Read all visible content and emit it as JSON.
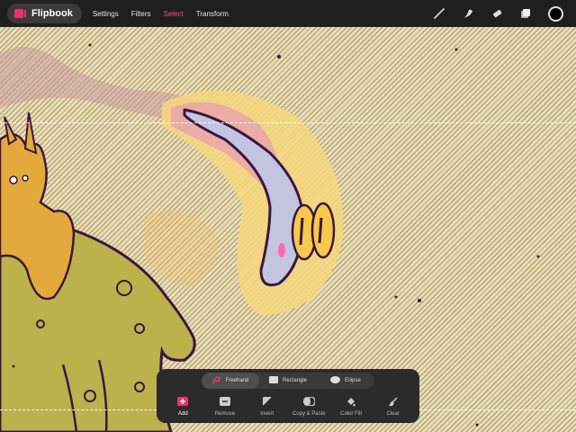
{
  "app": {
    "name": "Flipbook"
  },
  "menu": [
    {
      "label": "Settings",
      "active": false
    },
    {
      "label": "Filters",
      "active": false
    },
    {
      "label": "Select",
      "active": true
    },
    {
      "label": "Transform",
      "active": false
    }
  ],
  "tools": [
    "brush-icon",
    "smudge-icon",
    "eraser-icon",
    "layers-icon",
    "color-swatch"
  ],
  "selection": {
    "modes": [
      {
        "label": "Freehand",
        "icon": "lasso-icon",
        "active": true
      },
      {
        "label": "Rectangle",
        "icon": "rectangle-icon",
        "active": false
      },
      {
        "label": "Ellipse",
        "icon": "ellipse-icon",
        "active": false
      }
    ],
    "actions": [
      {
        "label": "Add",
        "icon": "add-icon",
        "active": true
      },
      {
        "label": "Remove",
        "icon": "remove-icon",
        "active": false
      },
      {
        "label": "Invert",
        "icon": "invert-icon",
        "active": false
      },
      {
        "label": "Copy & Paste",
        "icon": "copy-paste-icon",
        "active": false
      },
      {
        "label": "Color Fill",
        "icon": "color-fill-icon",
        "active": false
      },
      {
        "label": "Clear",
        "icon": "clear-icon",
        "active": false
      }
    ]
  },
  "colors": {
    "accent": "#e8336b",
    "active_color": "#000000"
  }
}
